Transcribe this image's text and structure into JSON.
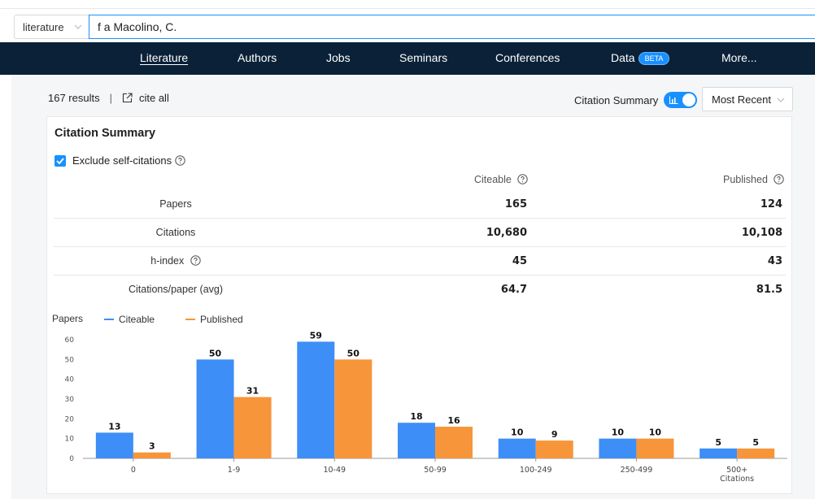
{
  "search": {
    "scope": "literature",
    "query": "f a Macolino, C."
  },
  "nav": {
    "items": [
      {
        "label": "Literature"
      },
      {
        "label": "Authors"
      },
      {
        "label": "Jobs"
      },
      {
        "label": "Seminars"
      },
      {
        "label": "Conferences"
      },
      {
        "label": "Data"
      },
      {
        "label": "More..."
      }
    ],
    "beta_badge": "BETA",
    "active": "Literature"
  },
  "results": {
    "count_text": "167 results",
    "separator": "|",
    "cite_all": "cite all"
  },
  "controls": {
    "citation_summary_label": "Citation Summary",
    "citation_summary_on": true,
    "sort": "Most Recent"
  },
  "summary": {
    "title": "Citation Summary",
    "exclude_self_citations": "Exclude self-citations",
    "exclude_checked": true,
    "columns": [
      "Citeable",
      "Published"
    ],
    "rows": [
      {
        "label": "Papers",
        "citeable": "165",
        "published": "124"
      },
      {
        "label": "Citations",
        "citeable": "10,680",
        "published": "10,108"
      },
      {
        "label": "h-index",
        "citeable": "45",
        "published": "43"
      },
      {
        "label": "Citations/paper (avg)",
        "citeable": "64.7",
        "published": "81.5"
      }
    ]
  },
  "colors": {
    "citeable": "#3e8ef7",
    "published": "#f7953a",
    "accent": "#1890ff",
    "navbar": "#0b2138"
  },
  "chart_data": {
    "type": "bar",
    "ylabel": "Papers",
    "categories": [
      "0",
      "1-9",
      "10-49",
      "50-99",
      "100-249",
      "250-499",
      "500+\nCitations"
    ],
    "series": [
      {
        "name": "Citeable",
        "values": [
          13,
          50,
          59,
          18,
          10,
          10,
          5
        ]
      },
      {
        "name": "Published",
        "values": [
          3,
          31,
          50,
          16,
          9,
          10,
          5
        ]
      }
    ],
    "yticks": [
      0,
      10,
      20,
      30,
      40,
      50,
      60
    ],
    "ylim": [
      0,
      60
    ],
    "legend": "top-left",
    "grid": false,
    "data_labels": true
  }
}
